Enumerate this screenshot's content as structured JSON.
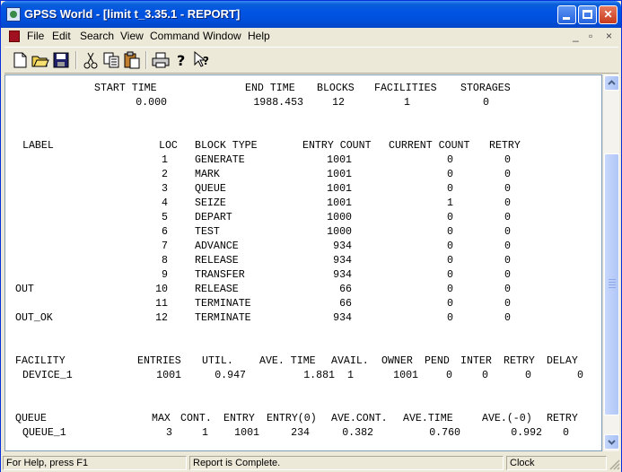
{
  "window": {
    "title": "GPSS World - [limit t_3.35.1  -  REPORT]"
  },
  "menu": [
    "File",
    "Edit",
    "Search",
    "View",
    "Command",
    "Window",
    "Help"
  ],
  "mdi_controls": [
    "_",
    "▫",
    "×"
  ],
  "toolbar_icons": [
    "new-icon",
    "open-icon",
    "save-icon",
    "cut-icon",
    "copy-icon",
    "paste-icon",
    "print-icon",
    "help-icon",
    "context-help-icon"
  ],
  "report": {
    "summary_headers": [
      "START TIME",
      "END TIME",
      "BLOCKS",
      "FACILITIES",
      "STORAGES"
    ],
    "summary_values": [
      "0.000",
      "1988.453",
      "12",
      "1",
      "0"
    ],
    "block_headers": [
      "LABEL",
      "LOC",
      "BLOCK TYPE",
      "ENTRY COUNT",
      "CURRENT COUNT",
      "RETRY"
    ],
    "blocks": [
      {
        "label": "",
        "loc": "1",
        "type": "GENERATE",
        "entry": "1001",
        "current": "0",
        "retry": "0"
      },
      {
        "label": "",
        "loc": "2",
        "type": "MARK",
        "entry": "1001",
        "current": "0",
        "retry": "0"
      },
      {
        "label": "",
        "loc": "3",
        "type": "QUEUE",
        "entry": "1001",
        "current": "0",
        "retry": "0"
      },
      {
        "label": "",
        "loc": "4",
        "type": "SEIZE",
        "entry": "1001",
        "current": "1",
        "retry": "0"
      },
      {
        "label": "",
        "loc": "5",
        "type": "DEPART",
        "entry": "1000",
        "current": "0",
        "retry": "0"
      },
      {
        "label": "",
        "loc": "6",
        "type": "TEST",
        "entry": "1000",
        "current": "0",
        "retry": "0"
      },
      {
        "label": "",
        "loc": "7",
        "type": "ADVANCE",
        "entry": "934",
        "current": "0",
        "retry": "0"
      },
      {
        "label": "",
        "loc": "8",
        "type": "RELEASE",
        "entry": "934",
        "current": "0",
        "retry": "0"
      },
      {
        "label": "",
        "loc": "9",
        "type": "TRANSFER",
        "entry": "934",
        "current": "0",
        "retry": "0"
      },
      {
        "label": "OUT",
        "loc": "10",
        "type": "RELEASE",
        "entry": "66",
        "current": "0",
        "retry": "0"
      },
      {
        "label": "",
        "loc": "11",
        "type": "TERMINATE",
        "entry": "66",
        "current": "0",
        "retry": "0"
      },
      {
        "label": "OUT_OK",
        "loc": "12",
        "type": "TERMINATE",
        "entry": "934",
        "current": "0",
        "retry": "0"
      }
    ],
    "facility_headers": [
      "FACILITY",
      "ENTRIES",
      "UTIL.",
      "AVE. TIME",
      "AVAIL.",
      "OWNER",
      "PEND",
      "INTER",
      "RETRY",
      "DELAY"
    ],
    "facility_row": [
      "DEVICE_1",
      "1001",
      "0.947",
      "1.881",
      "1",
      "1001",
      "0",
      "0",
      "0",
      "0"
    ],
    "queue_headers": [
      "QUEUE",
      "MAX",
      "CONT.",
      "ENTRY",
      "ENTRY(0)",
      "AVE.CONT.",
      "AVE.TIME",
      "AVE.(-0)",
      "RETRY"
    ],
    "queue_row": [
      "QUEUE_1",
      "3",
      "1",
      "1001",
      "234",
      "0.382",
      "0.760",
      "0.992",
      "0"
    ]
  },
  "status": {
    "help": "For Help, press F1",
    "message": "Report is Complete.",
    "clock": "Clock"
  }
}
